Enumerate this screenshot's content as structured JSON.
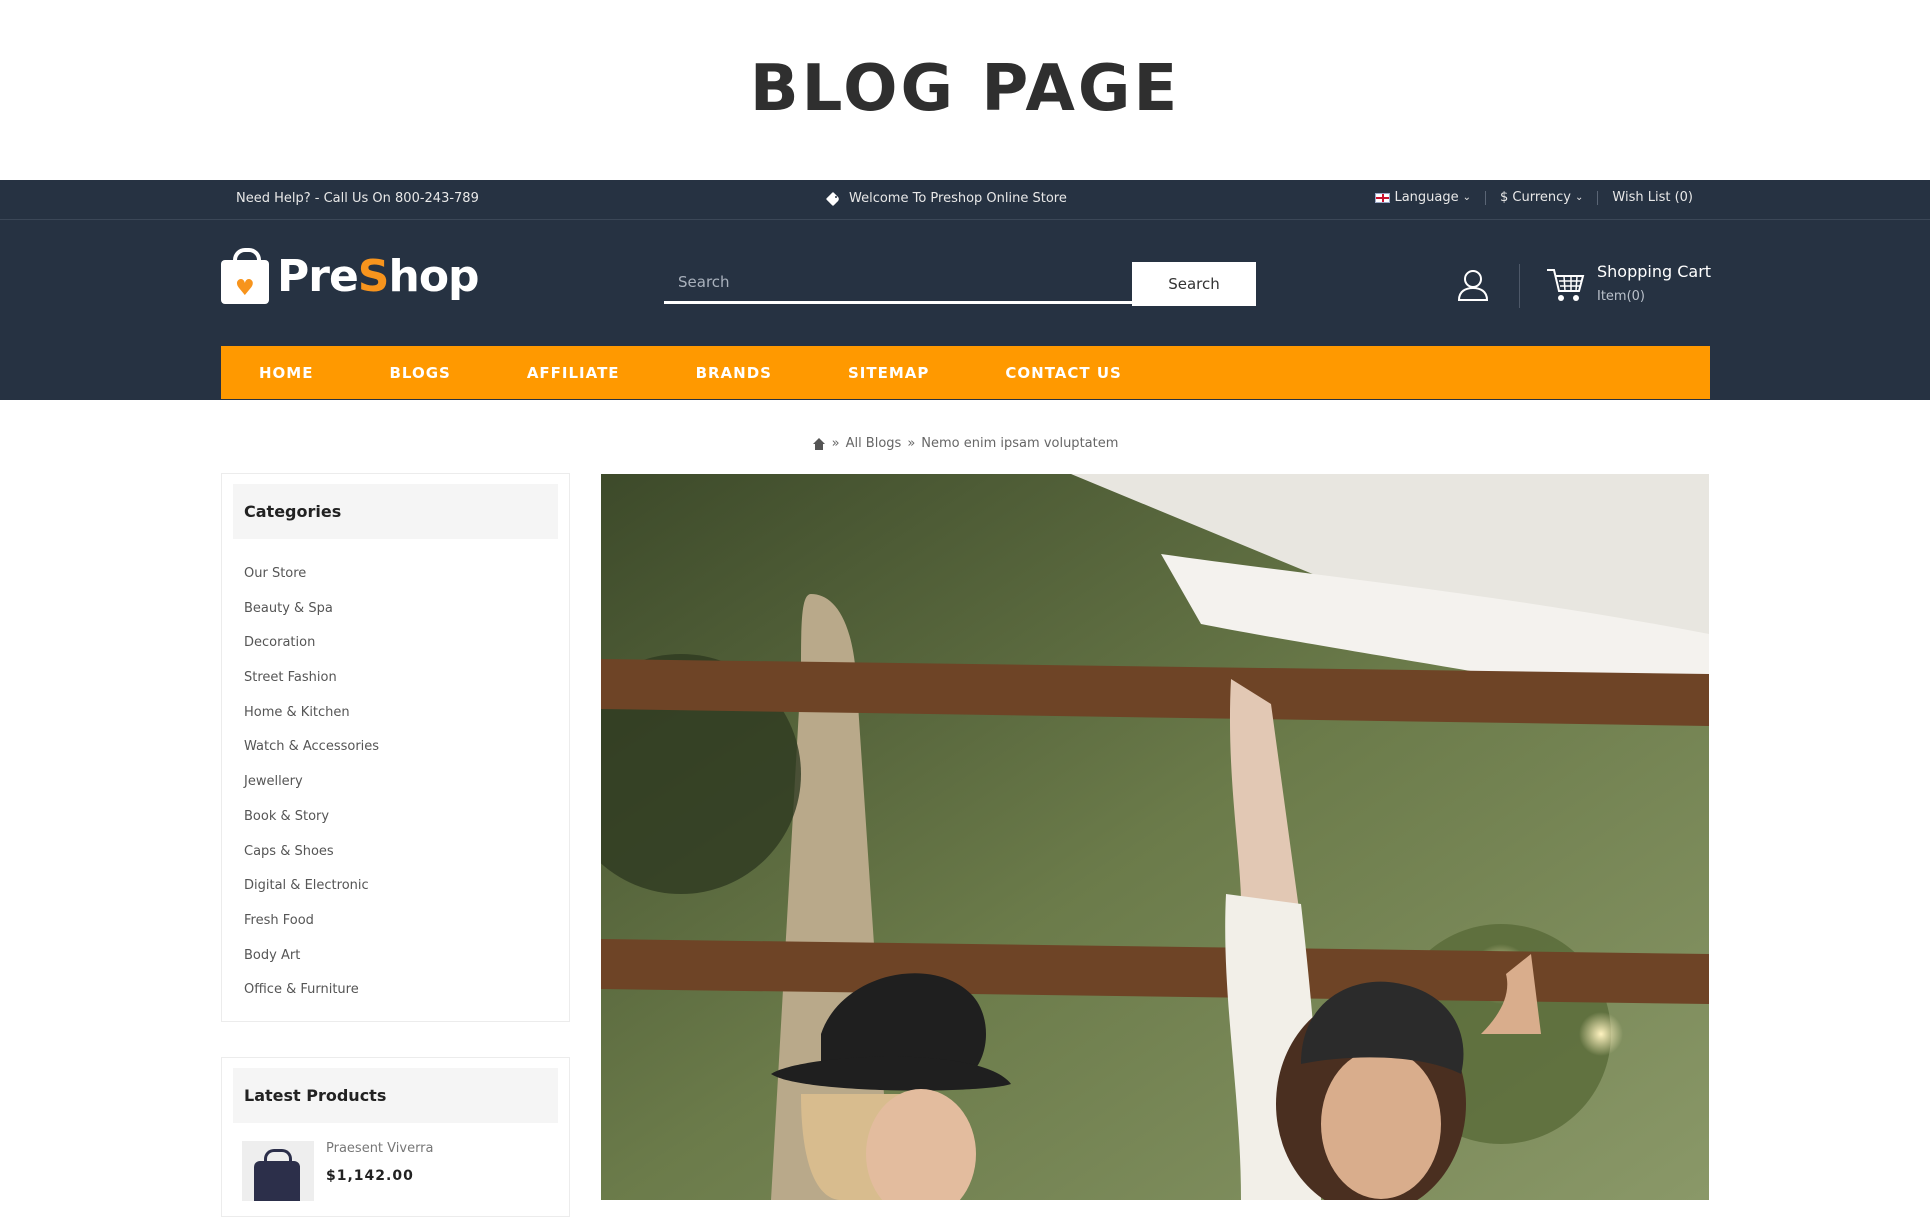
{
  "banner": {
    "title": "BLOG PAGE"
  },
  "topbar": {
    "help": "Need Help? - Call Us On 800-243-789",
    "welcome": "Welcome To Preshop Online Store",
    "language": "Language",
    "currency": "$ Currency",
    "wishlist": "Wish List (0)"
  },
  "header": {
    "logo_pre": "Pre",
    "logo_s": "S",
    "logo_hop": "hop",
    "search_placeholder": "Search",
    "search_button": "Search",
    "cart_title": "Shopping Cart",
    "cart_count": "Item(0)"
  },
  "nav": {
    "items": [
      "HOME",
      "BLOGS",
      "AFFILIATE",
      "BRANDS",
      "SITEMAP",
      "CONTACT US"
    ]
  },
  "breadcrumb": {
    "sep": "»",
    "all_blogs": "All Blogs",
    "current": "Nemo enim ipsam voluptatem"
  },
  "sidebar": {
    "categories_title": "Categories",
    "categories": [
      "Our Store",
      "Beauty & Spa",
      "Decoration",
      "Street Fashion",
      "Home & Kitchen",
      "Watch & Accessories",
      "Jewellery",
      "Book & Story",
      "Caps & Shoes",
      "Digital & Electronic",
      "Fresh Food",
      "Body Art",
      "Office & Furniture"
    ],
    "latest_title": "Latest Products",
    "latest_product": {
      "name": "Praesent Viverra",
      "price": "$1,142.00"
    }
  },
  "colors": {
    "header_bg": "#263242",
    "accent": "#ff9900",
    "logo_accent": "#f7941d"
  }
}
